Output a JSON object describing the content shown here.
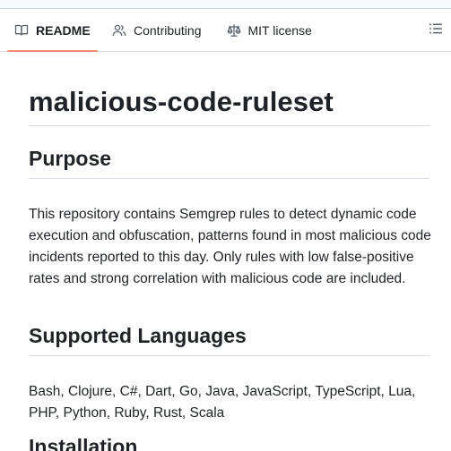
{
  "tabs": [
    {
      "label": "README",
      "icon": "book-icon",
      "active": true
    },
    {
      "label": "Contributing",
      "icon": "people-icon",
      "active": false
    },
    {
      "label": "MIT license",
      "icon": "law-scale-icon",
      "active": false
    }
  ],
  "toc_button": {
    "icon": "list-unordered-icon"
  },
  "readme": {
    "title": "malicious-code-ruleset",
    "sections": [
      {
        "heading": "Purpose",
        "body": "This repository contains Semgrep rules to detect dynamic code execution and obfuscation, patterns found in most malicious code incidents reported to this day. Only rules with low false-positive rates and strong correlation with malicious code are included."
      },
      {
        "heading": "Supported Languages",
        "body": "Bash, Clojure, C#, Dart, Go, Java, JavaScript, TypeScript, Lua, PHP, Python, Ruby, Rust, Scala"
      },
      {
        "heading": "Installation",
        "body": ""
      }
    ]
  },
  "colors": {
    "active_tab_underline": "#fd8c73",
    "text": "#1f2328",
    "divider": "#d8dee4"
  }
}
